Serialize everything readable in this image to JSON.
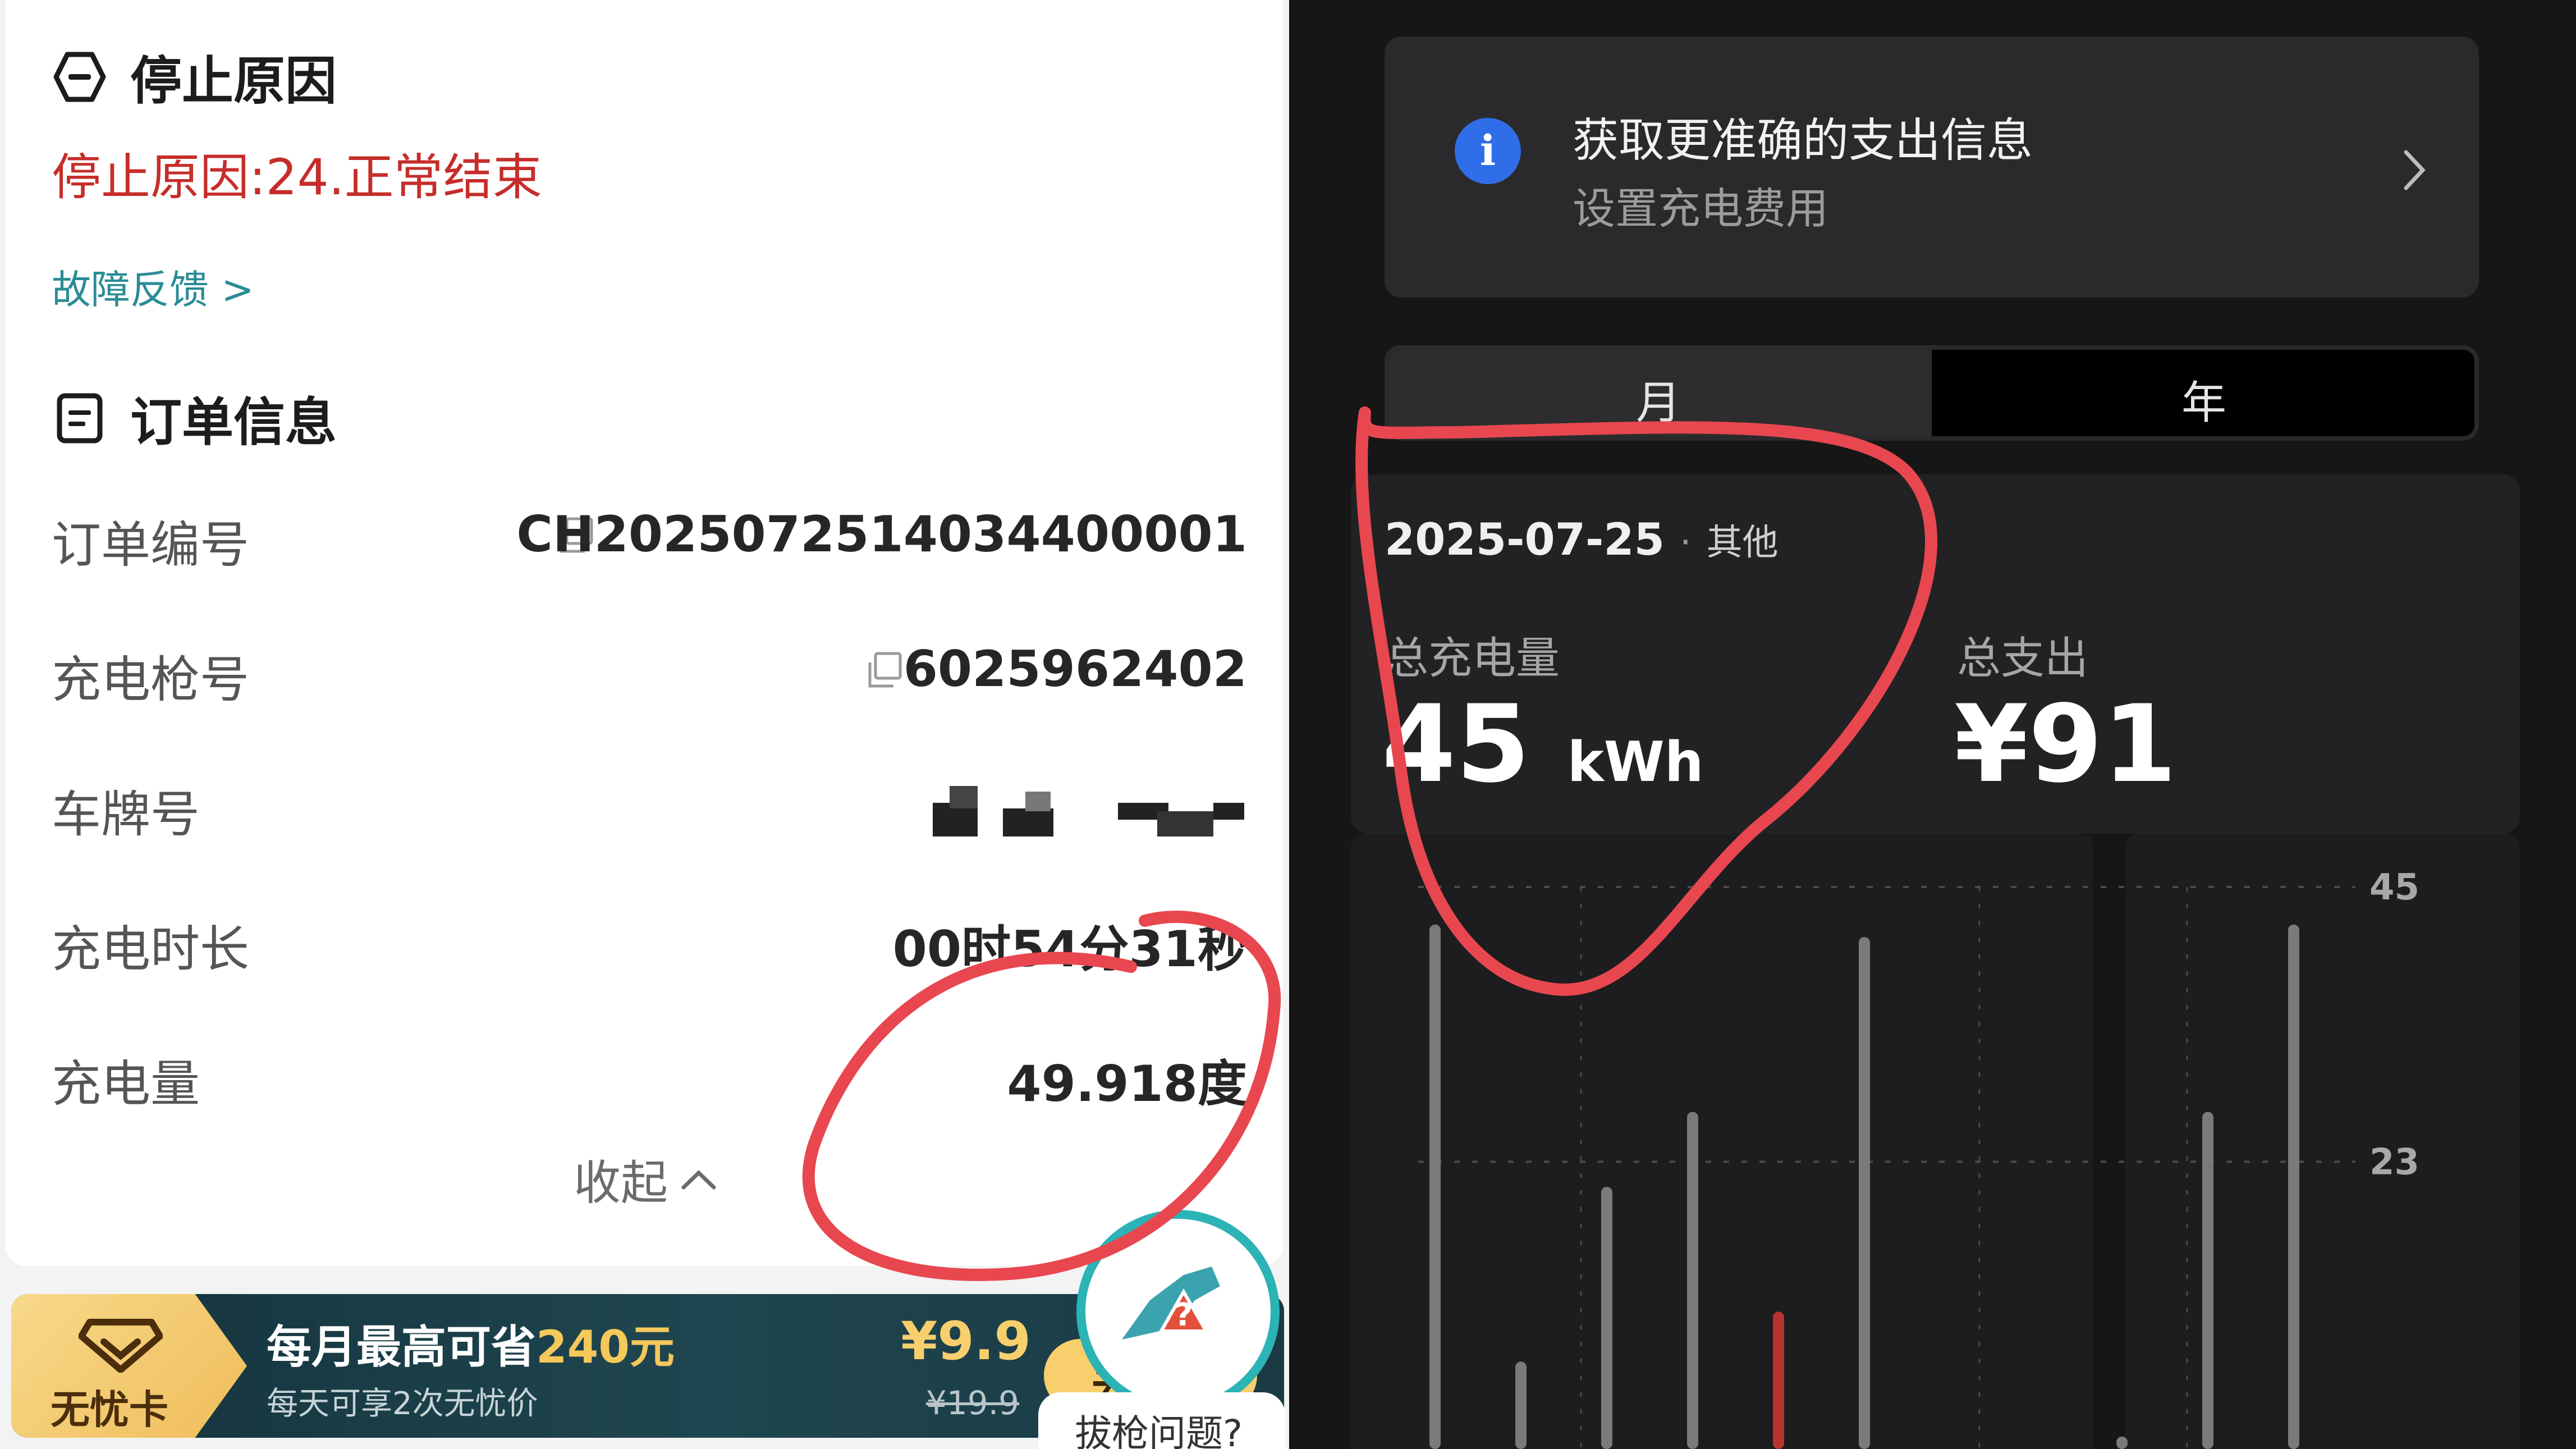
{
  "left_panel": {
    "stop_section": {
      "title": "停止原因",
      "reason": "停止原因:24.正常结束",
      "feedback_link": "故障反馈 >"
    },
    "order_section": {
      "title": "订单信息",
      "rows": [
        {
          "label": "订单编号",
          "value": "CH2025072514034400001",
          "copyable": true
        },
        {
          "label": "充电枪号",
          "value": "6025962402",
          "copyable": true
        },
        {
          "label": "车牌号",
          "value": "",
          "redacted": true
        },
        {
          "label": "充电时长",
          "value": "00时54分31秒"
        },
        {
          "label": "充电量",
          "value": "49.918度"
        }
      ],
      "collapse_label": "收起"
    },
    "banner": {
      "badge": "无忧卡",
      "title_prefix": "每月最高可省",
      "title_highlight": "240元",
      "subtitle": "每天可享2次无忧价",
      "price": "¥9.9",
      "original_price": "¥19.9",
      "action": "去"
    },
    "plug_help": {
      "label": "拔枪问题?"
    }
  },
  "right_panel": {
    "info_card": {
      "title": "获取更准确的支出信息",
      "subtitle": "设置充电费用"
    },
    "period_tabs": {
      "items": [
        "月",
        "年"
      ],
      "selected": "月"
    },
    "summary": {
      "date": "2025-07-25",
      "separator": "·",
      "category": "其他",
      "energy_label": "总充电量",
      "energy_value": "45",
      "energy_unit": "kWh",
      "cost_label": "总支出",
      "cost_value": "¥91"
    },
    "chart_data": {
      "type": "bar",
      "y_tick_labels": [
        "45",
        "23"
      ],
      "ylim": [
        0,
        45
      ],
      "values": [
        42,
        7,
        21,
        27,
        11,
        41,
        0,
        0,
        1,
        27,
        42
      ],
      "highlight_index": 4,
      "colors": {
        "bar": "#7a7a7c",
        "highlight": "#b9342f",
        "grid": "#4a4a4c"
      }
    }
  },
  "colors": {
    "alert_red": "#c62d2a",
    "link_teal": "#2a8c96",
    "info_blue": "#2f6ee8",
    "annotation_red": "#e8474f"
  }
}
